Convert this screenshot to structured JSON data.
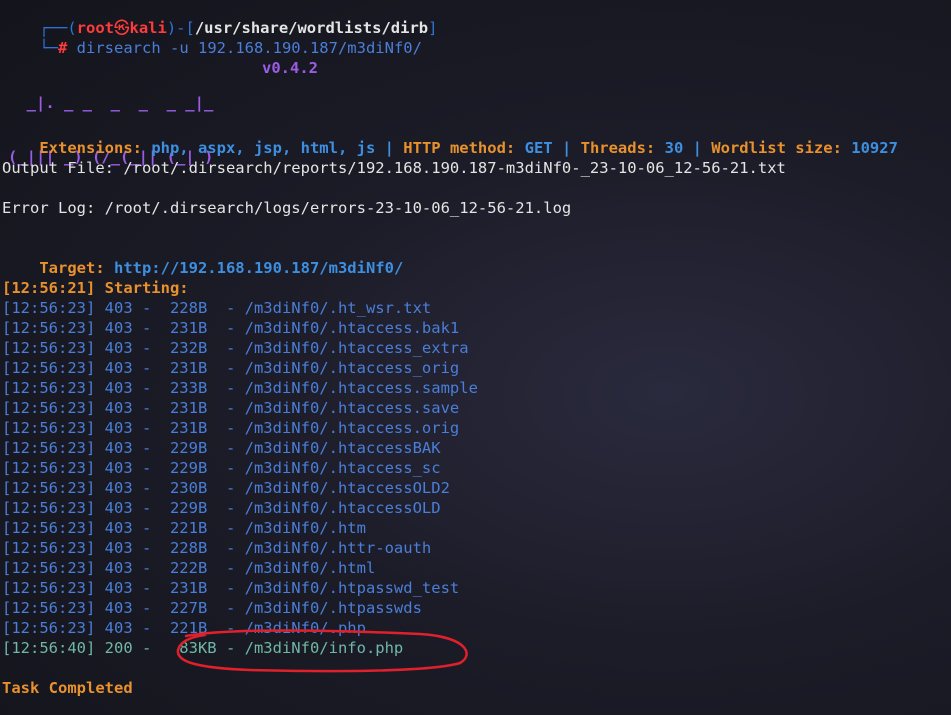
{
  "prompt": {
    "frame_top": "┌──(",
    "user": "root",
    "at": "㉿",
    "host": "kali",
    "mid": ")-[",
    "path": "/usr/share/wordlists/dirb",
    "close": "]",
    "frame_bottom": "└─",
    "hash": "#",
    "command": " dirsearch -u 192.168.190.187/m3diNf0/"
  },
  "banner": {
    "line1": "  _|. _ _  _  _  _ _|_",
    "line2": "(_||| _) (/_(_|| (_| )",
    "version": "v0.4.2"
  },
  "config": {
    "ext_label": "Extensions: ",
    "ext_value": "php, aspx, jsp, html, js",
    "sep": " | ",
    "method_label": "HTTP method: ",
    "method_value": "GET",
    "threads_label": "Threads: ",
    "threads_value": "30",
    "wordlist_label": "Wordlist size: ",
    "wordlist_value": "10927"
  },
  "output_file": "Output File: /root/.dirsearch/reports/192.168.190.187-m3diNf0-_23-10-06_12-56-21.txt",
  "error_log": "Error Log: /root/.dirsearch/logs/errors-23-10-06_12-56-21.log",
  "target": {
    "label": "Target: ",
    "url": "http://192.168.190.187/m3diNf0/"
  },
  "starting": "[12:56:21] Starting:",
  "results": [
    "[12:56:23] 403 -  228B  - /m3diNf0/.ht_wsr.txt",
    "[12:56:23] 403 -  231B  - /m3diNf0/.htaccess.bak1",
    "[12:56:23] 403 -  232B  - /m3diNf0/.htaccess_extra",
    "[12:56:23] 403 -  231B  - /m3diNf0/.htaccess_orig",
    "[12:56:23] 403 -  233B  - /m3diNf0/.htaccess.sample",
    "[12:56:23] 403 -  231B  - /m3diNf0/.htaccess.save",
    "[12:56:23] 403 -  231B  - /m3diNf0/.htaccess.orig",
    "[12:56:23] 403 -  229B  - /m3diNf0/.htaccessBAK",
    "[12:56:23] 403 -  229B  - /m3diNf0/.htaccess_sc",
    "[12:56:23] 403 -  230B  - /m3diNf0/.htaccessOLD2",
    "[12:56:23] 403 -  229B  - /m3diNf0/.htaccessOLD",
    "[12:56:23] 403 -  221B  - /m3diNf0/.htm",
    "[12:56:23] 403 -  228B  - /m3diNf0/.httr-oauth",
    "[12:56:23] 403 -  222B  - /m3diNf0/.html",
    "[12:56:23] 403 -  231B  - /m3diNf0/.htpasswd_test",
    "[12:56:23] 403 -  227B  - /m3diNf0/.htpasswds",
    "[12:56:23] 403 -  221B  - /m3diNf0/.php",
    "[12:56:40] 200 -   83KB - /m3diNf0/info.php"
  ],
  "completed": "Task Completed",
  "colors": {
    "orange": "#e8912d",
    "blue": "#3d8fe0",
    "red": "#ff3b3b",
    "purple": "#9b5de5",
    "annotation": "#e0202a"
  }
}
